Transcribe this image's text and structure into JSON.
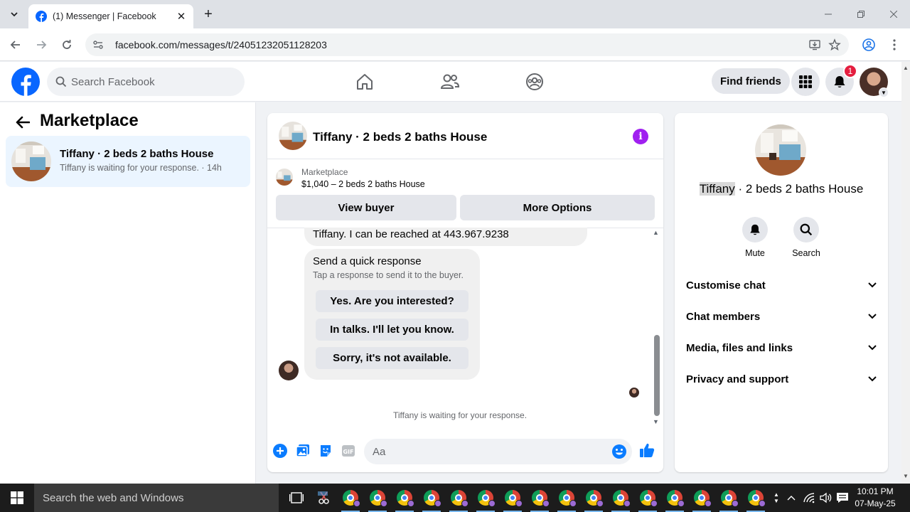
{
  "browser": {
    "tab_title": "(1) Messenger | Facebook",
    "url": "facebook.com/messages/t/24051232051128203"
  },
  "header": {
    "search_placeholder": "Search Facebook",
    "find_friends": "Find friends",
    "notification_count": "1"
  },
  "left_panel": {
    "title": "Marketplace",
    "conversation": {
      "name": "Tiffany · 2 beds 2 baths House",
      "preview": "Tiffany is waiting for your response. · 14h"
    }
  },
  "chat": {
    "title": "Tiffany · 2 beds 2 baths House",
    "marketplace_label": "Marketplace",
    "listing": "$1,040 – 2 beds 2 baths House",
    "view_buyer": "View buyer",
    "more_options": "More Options",
    "prev_message": "Tiffany. I can be reached at 443.967.9238",
    "quick_title": "Send a quick response",
    "quick_sub": "Tap a response to send it to the buyer.",
    "quick_options": [
      "Yes. Are you interested?",
      "In talks. I'll let you know.",
      "Sorry, it's not available."
    ],
    "waiting": "Tiffany is waiting for your response.",
    "composer_placeholder": "Aa"
  },
  "right_panel": {
    "name_first": "Tiffany",
    "name_rest": " · 2 beds 2 baths House",
    "mute": "Mute",
    "search": "Search",
    "sections": [
      "Customise chat",
      "Chat members",
      "Media, files and links",
      "Privacy and support"
    ]
  },
  "taskbar": {
    "search_placeholder": "Search the web and Windows",
    "time": "10:01 PM",
    "date": "07-May-25"
  },
  "colors": {
    "fb_blue": "#0866ff",
    "accent_purple": "#a020f0",
    "messenger_blue": "#0a7cff"
  }
}
